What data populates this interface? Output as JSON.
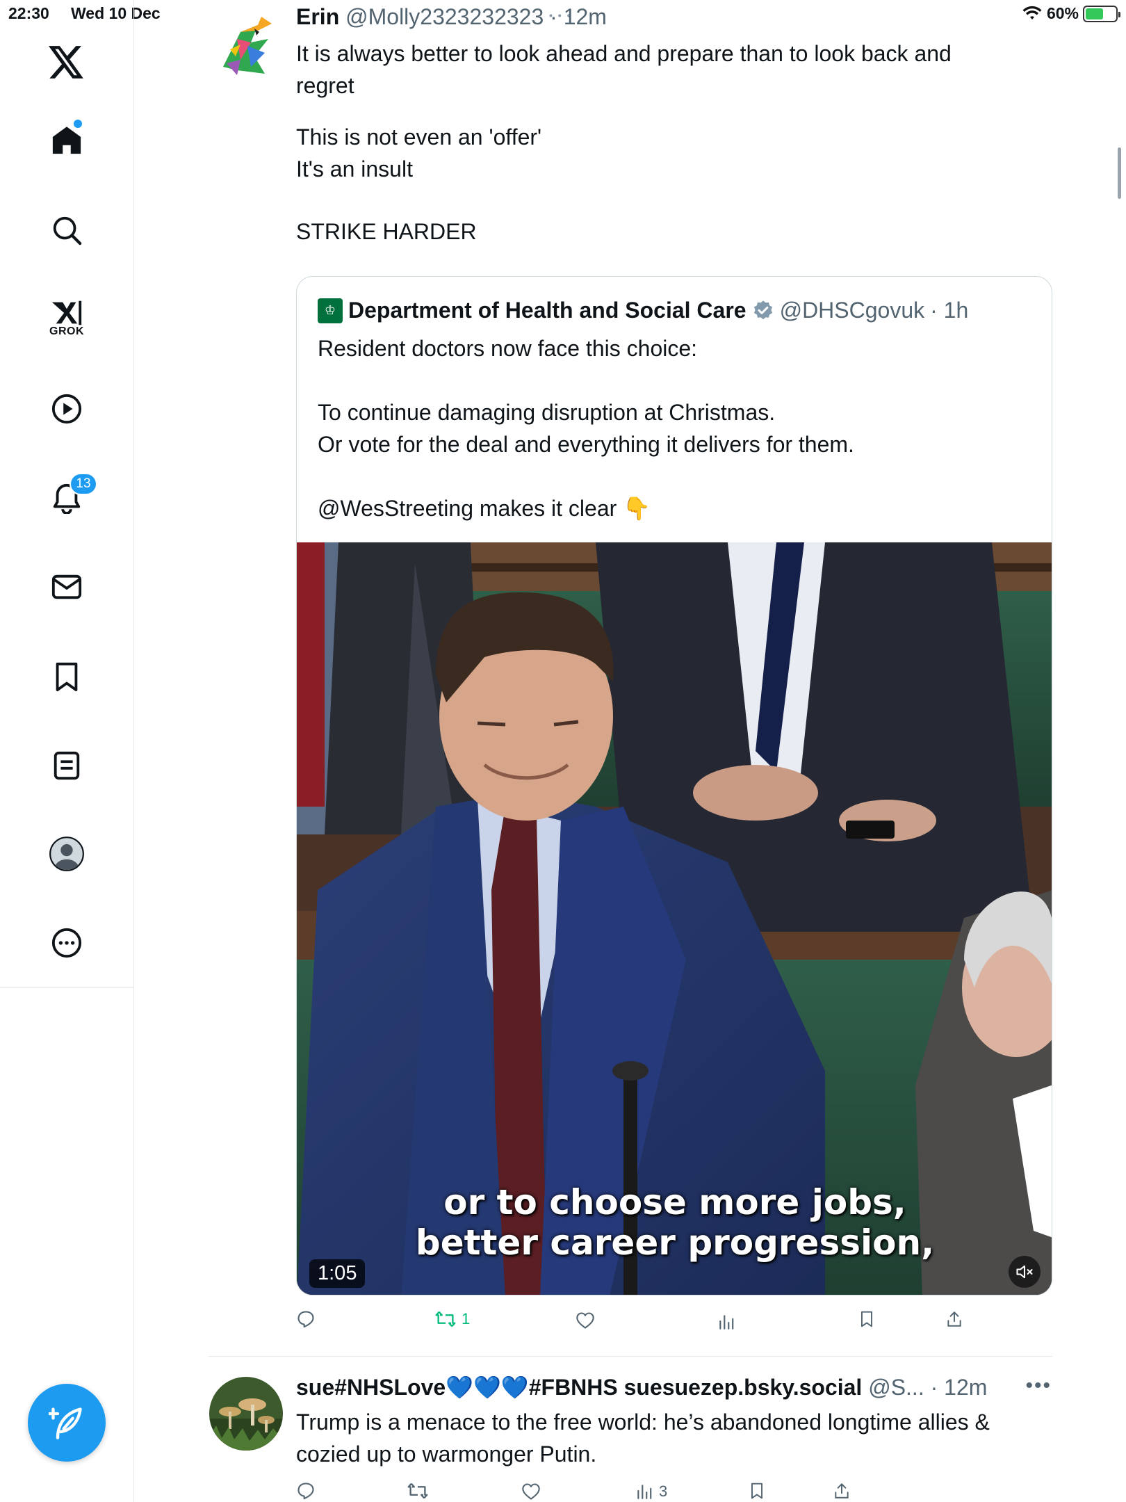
{
  "status_bar": {
    "time": "22:30",
    "date": "Wed 10 Dec",
    "battery": "60%",
    "battery_level": 0.6
  },
  "sidebar": {
    "grok_label": "GROK",
    "notifications_count": "13",
    "icons": [
      "x-logo-icon",
      "home-icon",
      "search-icon",
      "grok-icon",
      "video-icon",
      "bell-icon",
      "mail-icon",
      "bookmark-icon",
      "lists-icon",
      "profile-icon",
      "more-icon",
      "compose-icon"
    ]
  },
  "tweets": [
    {
      "name": "Erin",
      "handle": "@Molly2323232323",
      "time": "· 12m",
      "text_lines": [
        "It is always better to look ahead and prepare than to look back and",
        "regret",
        "",
        "This is not even an 'offer'",
        "It's an insult",
        "",
        "STRIKE HARDER"
      ],
      "quote": {
        "name": "Department of Health and Social Care",
        "handle": "@DHSCgovuk",
        "time": "· 1h",
        "text_lines": [
          "Resident doctors now face this choice:",
          "",
          "To continue damaging disruption at Christmas.",
          "Or vote for the deal and everything it delivers for them.",
          "",
          "@WesStreeting makes it clear 👇"
        ],
        "video": {
          "caption_line1": "or to choose more jobs,",
          "caption_line2": "better career progression,",
          "duration": "1:05"
        }
      },
      "actions": {
        "replies": "",
        "reposts": "1",
        "likes": "",
        "views": "",
        "reposted": true
      }
    },
    {
      "name": "sue#NHSLove💙💙💙#FBNHS suesuezep.bsky.social",
      "handle": "@S...",
      "time": "· 12m",
      "text_lines": [
        "Trump is a menace to the free world: he’s abandoned longtime allies &",
        "cozied up to warmonger Putin."
      ],
      "actions": {
        "replies": "",
        "reposts": "",
        "likes": "",
        "views": "3"
      }
    }
  ]
}
